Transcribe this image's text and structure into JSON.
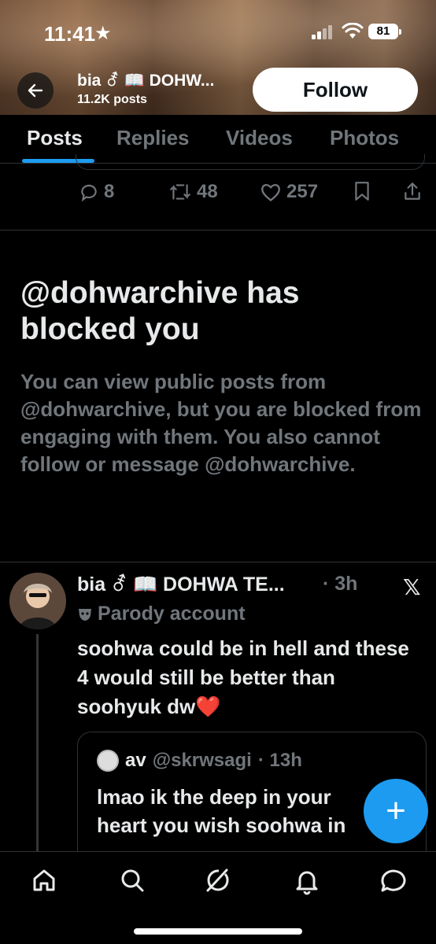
{
  "status_bar": {
    "time": "11:41",
    "battery": "81"
  },
  "header": {
    "name": "bia ⚦ 📖 DOHW...",
    "post_count": "11.2K posts",
    "follow_label": "Follow"
  },
  "tabs": [
    {
      "label": "Posts",
      "active": true
    },
    {
      "label": "Replies",
      "active": false
    },
    {
      "label": "Videos",
      "active": false
    },
    {
      "label": "Photos",
      "active": false
    }
  ],
  "previous_post_actions": {
    "replies": "8",
    "reposts": "48",
    "likes": "257"
  },
  "blocked_notice": {
    "title": "@dohwarchive has blocked you",
    "body": "You can view public posts from @dohwarchive, but you are blocked from engaging with them. You also cannot follow or message @dohwarchive."
  },
  "tweet": {
    "name": "bia ⚦ 📖 DOHWA TE...",
    "time": "· 3h",
    "parody_label": "Parody account",
    "text": "soohwa could be in hell and these 4 would still be better than soohyuk dw❤️",
    "quote": {
      "name": "av",
      "handle": "@skrwsagi",
      "time": "· 13h",
      "text": "lmao ik the deep in your heart you wish soohwa in"
    }
  },
  "fab_label": "+",
  "colors": {
    "accent": "#1d9bf0",
    "muted": "#71767b",
    "border": "#2f3336"
  },
  "icons": [
    "back-arrow-icon",
    "reply-icon",
    "repost-icon",
    "like-icon",
    "bookmark-icon",
    "share-icon",
    "x-logo-icon",
    "home-icon",
    "search-icon",
    "grok-icon",
    "notifications-icon",
    "messages-icon"
  ]
}
